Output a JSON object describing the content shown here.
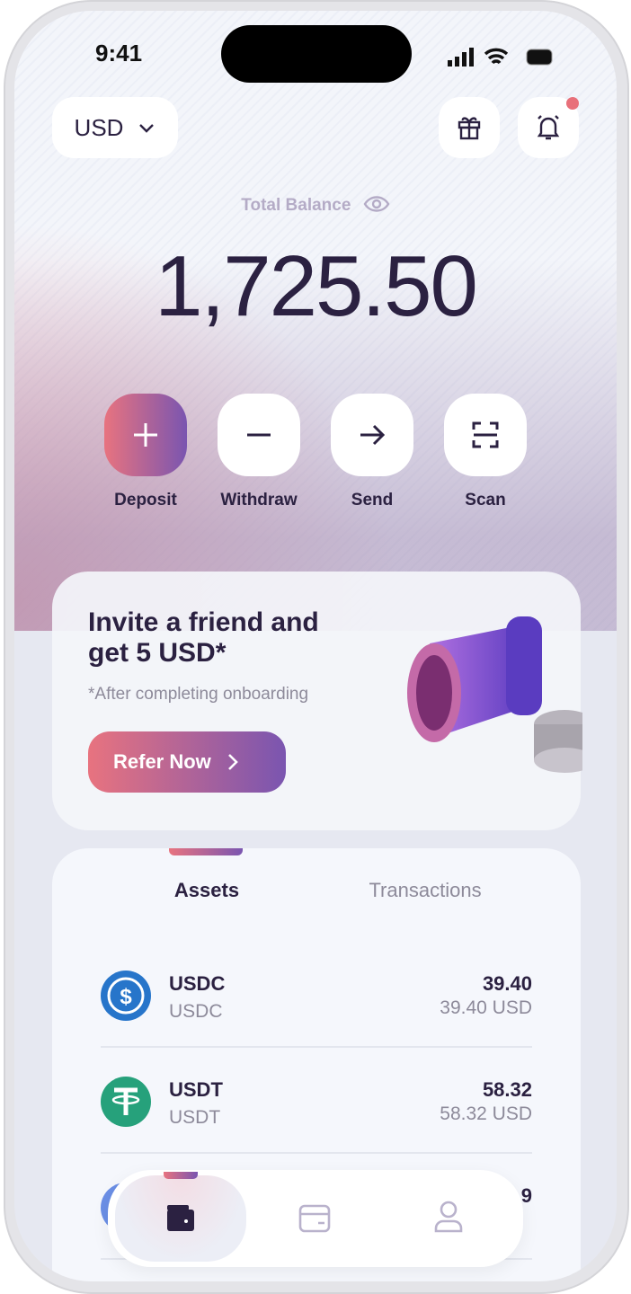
{
  "status": {
    "time": "9:41"
  },
  "header": {
    "currency": "USD"
  },
  "balance": {
    "label": "Total Balance",
    "amount": "1,725.50"
  },
  "actions": [
    {
      "label": "Deposit"
    },
    {
      "label": "Withdraw"
    },
    {
      "label": "Send"
    },
    {
      "label": "Scan"
    }
  ],
  "promo": {
    "title_line1": "Invite a friend and",
    "title_line2": "get 5 USD*",
    "note": "*After completing onboarding",
    "button": "Refer Now"
  },
  "tabs": [
    {
      "label": "Assets",
      "active": true
    },
    {
      "label": "Transactions",
      "active": false
    }
  ],
  "assets": [
    {
      "name": "USDC",
      "symbol": "USDC",
      "amount": "39.40",
      "fiat": "39.40 USD",
      "color": "#2775ca"
    },
    {
      "name": "USDT",
      "symbol": "USDT",
      "amount": "58.32",
      "fiat": "58.32 USD",
      "color": "#26a17b"
    },
    {
      "amount": "9",
      "color": "#6b8fe6"
    }
  ],
  "nav": [
    {
      "icon": "wallet-icon",
      "active": true
    },
    {
      "icon": "card-icon"
    },
    {
      "icon": "user-icon"
    }
  ],
  "colors": {
    "primary": "#2b2141",
    "accent_start": "#e8737f",
    "accent_end": "#7a55b0",
    "notification": "#e8707a"
  }
}
